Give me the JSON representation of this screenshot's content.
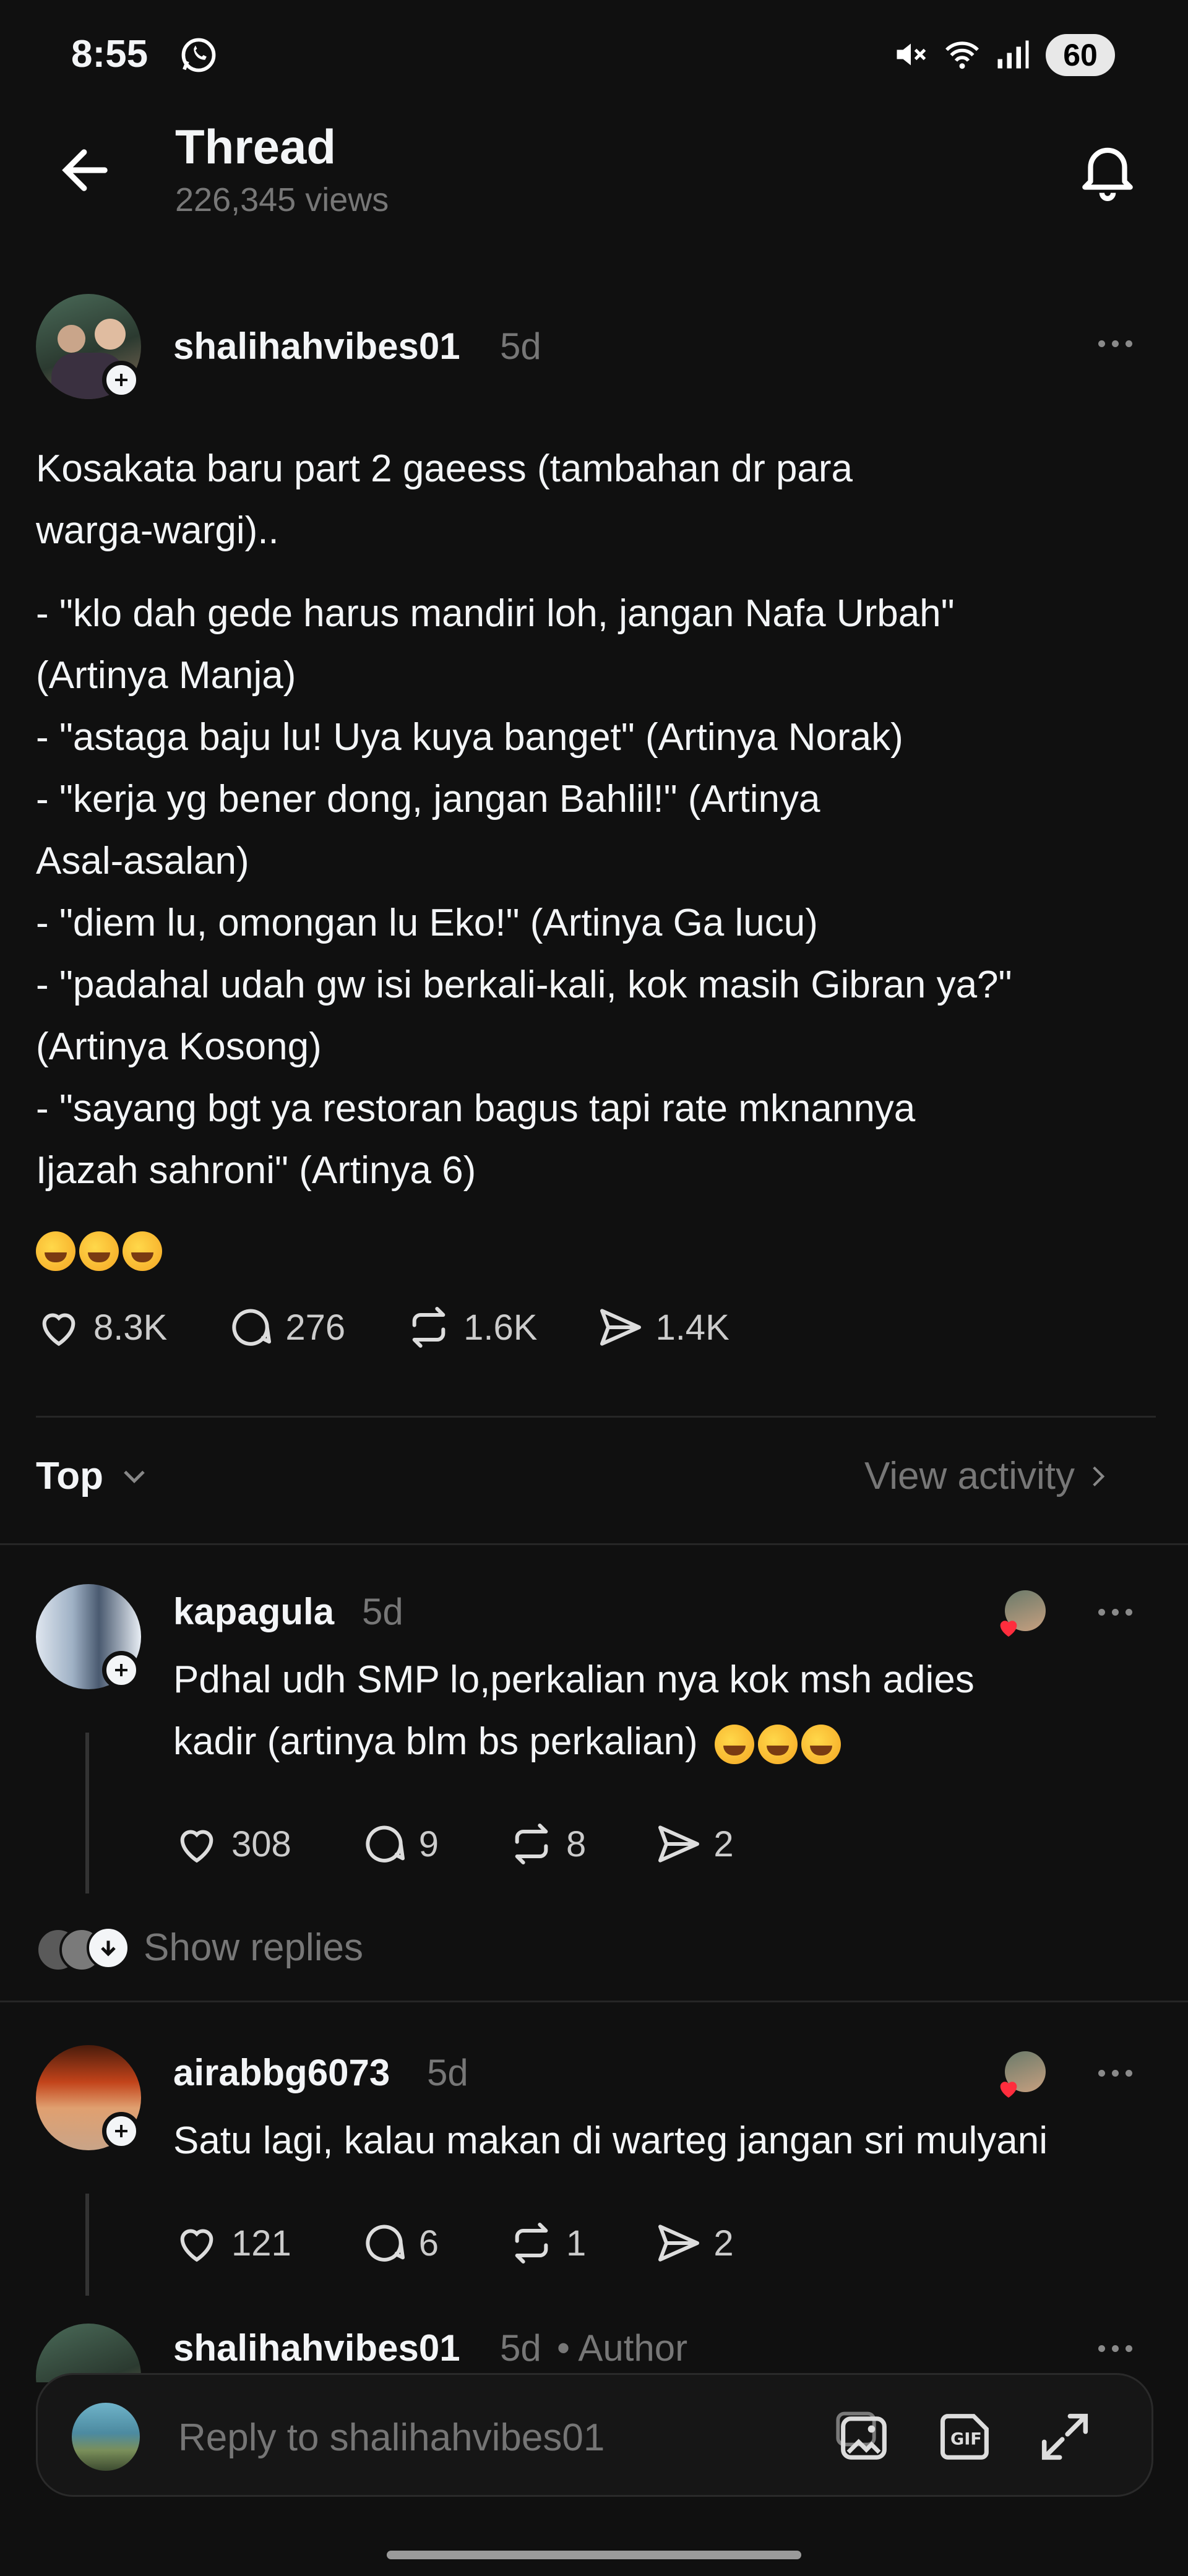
{
  "status_bar": {
    "time": "8:55",
    "battery": "60"
  },
  "header": {
    "title": "Thread",
    "views": "226,345 views"
  },
  "post": {
    "username": "shalihahvibes01",
    "age": "5d",
    "lines": [
      "Kosakata baru part 2 gaeess (tambahan dr para",
      "warga-wargi).."
    ],
    "list_lines": [
      "- \"klo dah gede harus mandiri loh, jangan Nafa Urbah\"",
      "(Artinya Manja)",
      "- \"astaga baju lu! Uya kuya banget\" (Artinya Norak)",
      "- \"kerja yg bener dong, jangan Bahlil!\" (Artinya",
      "Asal-asalan)",
      "- \"diem lu, omongan lu Eko!\" (Artinya Ga lucu)",
      "- \"padahal udah gw isi berkali-kali, kok masih Gibran ya?\"",
      "(Artinya Kosong)",
      "- \"sayang bgt ya restoran bagus tapi rate mknannya",
      "Ijazah sahroni\" (Artinya 6)"
    ],
    "emoji_count": 3,
    "likes": "8.3K",
    "comments": "276",
    "reposts": "1.6K",
    "shares": "1.4K"
  },
  "filter": {
    "sort_label": "Top",
    "view_activity": "View activity"
  },
  "replies": [
    {
      "username": "kapagula",
      "age": "5d",
      "text_lines": [
        "Pdhal udh SMP lo,perkalian nya kok msh adies",
        "kadir (artinya blm bs perkalian)"
      ],
      "likes": "308",
      "comments": "9",
      "reposts": "8",
      "shares": "2",
      "show_replies": "Show replies"
    },
    {
      "username": "airabbg6073",
      "age": "5d",
      "text_lines": [
        "Satu lagi, kalau makan di warteg jangan sri mulyani"
      ],
      "likes": "121",
      "comments": "6",
      "reposts": "1",
      "shares": "2"
    }
  ],
  "partial_reply": {
    "username": "shalihahvibes01",
    "age": "5d",
    "author_tag": "• Author"
  },
  "composer": {
    "placeholder": "Reply to shalihahvibes01"
  }
}
